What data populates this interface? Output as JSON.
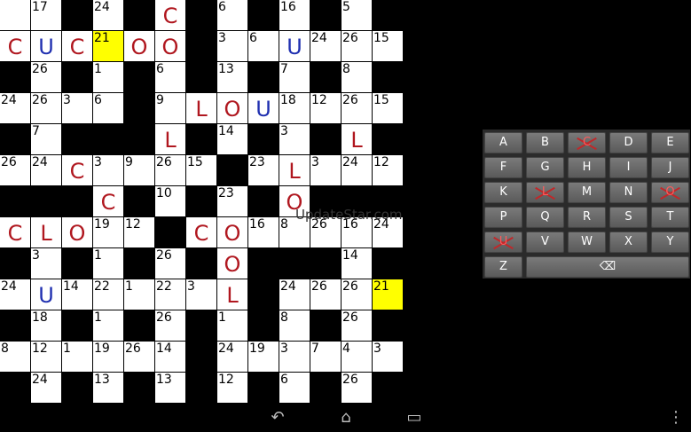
{
  "grid": {
    "rows": [
      [
        {
          "t": "w"
        },
        {
          "t": "w",
          "n": "17"
        },
        {
          "t": "b"
        },
        {
          "t": "w",
          "n": "24"
        },
        {
          "t": "b"
        },
        {
          "t": "w",
          "l": "C",
          "c": "red"
        },
        {
          "t": "b"
        },
        {
          "t": "w",
          "n": "6"
        },
        {
          "t": "b"
        },
        {
          "t": "w",
          "n": "16"
        },
        {
          "t": "b"
        },
        {
          "t": "w",
          "n": "5"
        },
        {
          "t": "b"
        }
      ],
      [
        {
          "t": "w",
          "l": "C",
          "c": "red"
        },
        {
          "t": "w",
          "l": "U",
          "c": "blue"
        },
        {
          "t": "w",
          "l": "C",
          "c": "red"
        },
        {
          "t": "h",
          "n": "21"
        },
        {
          "t": "w",
          "l": "O",
          "c": "red"
        },
        {
          "t": "w",
          "l": "O",
          "c": "red"
        },
        {
          "t": "b"
        },
        {
          "t": "w",
          "n": "3"
        },
        {
          "t": "w",
          "n": "6"
        },
        {
          "t": "w",
          "l": "U",
          "c": "blue"
        },
        {
          "t": "w",
          "n": "24"
        },
        {
          "t": "w",
          "n": "26"
        },
        {
          "t": "w",
          "n": "15"
        }
      ],
      [
        {
          "t": "b"
        },
        {
          "t": "w",
          "n": "26"
        },
        {
          "t": "b"
        },
        {
          "t": "w",
          "n": "1"
        },
        {
          "t": "b"
        },
        {
          "t": "w",
          "n": "6"
        },
        {
          "t": "b"
        },
        {
          "t": "w",
          "n": "13"
        },
        {
          "t": "b"
        },
        {
          "t": "w",
          "n": "7"
        },
        {
          "t": "b"
        },
        {
          "t": "w",
          "n": "8"
        },
        {
          "t": "b"
        }
      ],
      [
        {
          "t": "w",
          "n": "24"
        },
        {
          "t": "w",
          "n": "26"
        },
        {
          "t": "w",
          "n": "3"
        },
        {
          "t": "w",
          "n": "6"
        },
        {
          "t": "b"
        },
        {
          "t": "w",
          "n": "9"
        },
        {
          "t": "w",
          "l": "L",
          "c": "red"
        },
        {
          "t": "w",
          "l": "O",
          "c": "red"
        },
        {
          "t": "w",
          "l": "U",
          "c": "blue"
        },
        {
          "t": "w",
          "n": "18"
        },
        {
          "t": "w",
          "n": "12"
        },
        {
          "t": "w",
          "n": "26"
        },
        {
          "t": "w",
          "n": "15"
        }
      ],
      [
        {
          "t": "b"
        },
        {
          "t": "w",
          "n": "7"
        },
        {
          "t": "b"
        },
        {
          "t": "b"
        },
        {
          "t": "b"
        },
        {
          "t": "w",
          "l": "L",
          "c": "red"
        },
        {
          "t": "b"
        },
        {
          "t": "w",
          "n": "14"
        },
        {
          "t": "b"
        },
        {
          "t": "w",
          "n": "3"
        },
        {
          "t": "b"
        },
        {
          "t": "w",
          "l": "L",
          "c": "red"
        },
        {
          "t": "b"
        }
      ],
      [
        {
          "t": "w",
          "n": "26"
        },
        {
          "t": "w",
          "n": "24"
        },
        {
          "t": "w",
          "l": "C",
          "c": "red"
        },
        {
          "t": "w",
          "n": "3"
        },
        {
          "t": "w",
          "n": "9"
        },
        {
          "t": "w",
          "n": "26"
        },
        {
          "t": "w",
          "n": "15"
        },
        {
          "t": "b"
        },
        {
          "t": "w",
          "n": "23"
        },
        {
          "t": "w",
          "l": "L",
          "c": "red"
        },
        {
          "t": "w",
          "n": "3"
        },
        {
          "t": "w",
          "n": "24"
        },
        {
          "t": "w",
          "n": "12"
        }
      ],
      [
        {
          "t": "b"
        },
        {
          "t": "b"
        },
        {
          "t": "b"
        },
        {
          "t": "w",
          "l": "C",
          "c": "red"
        },
        {
          "t": "b"
        },
        {
          "t": "w",
          "n": "10"
        },
        {
          "t": "b"
        },
        {
          "t": "w",
          "n": "23"
        },
        {
          "t": "b"
        },
        {
          "t": "w",
          "l": "O",
          "c": "red"
        },
        {
          "t": "b"
        },
        {
          "t": "b"
        },
        {
          "t": "b"
        }
      ],
      [
        {
          "t": "w",
          "l": "C",
          "c": "red"
        },
        {
          "t": "w",
          "l": "L",
          "c": "red"
        },
        {
          "t": "w",
          "l": "O",
          "c": "red"
        },
        {
          "t": "w",
          "n": "19"
        },
        {
          "t": "w",
          "n": "12"
        },
        {
          "t": "b"
        },
        {
          "t": "w",
          "l": "C",
          "c": "red"
        },
        {
          "t": "w",
          "l": "O",
          "c": "red"
        },
        {
          "t": "w",
          "n": "16"
        },
        {
          "t": "w",
          "n": "8"
        },
        {
          "t": "w",
          "n": "26"
        },
        {
          "t": "w",
          "n": "16"
        },
        {
          "t": "w",
          "n": "24"
        }
      ],
      [
        {
          "t": "b"
        },
        {
          "t": "w",
          "n": "3"
        },
        {
          "t": "b"
        },
        {
          "t": "w",
          "n": "1"
        },
        {
          "t": "b"
        },
        {
          "t": "w",
          "n": "26"
        },
        {
          "t": "b"
        },
        {
          "t": "w",
          "l": "O",
          "c": "red"
        },
        {
          "t": "b"
        },
        {
          "t": "b"
        },
        {
          "t": "b"
        },
        {
          "t": "w",
          "n": "14"
        },
        {
          "t": "b"
        }
      ],
      [
        {
          "t": "w",
          "n": "24"
        },
        {
          "t": "w",
          "l": "U",
          "c": "blue"
        },
        {
          "t": "w",
          "n": "14"
        },
        {
          "t": "w",
          "n": "22"
        },
        {
          "t": "w",
          "n": "1"
        },
        {
          "t": "w",
          "n": "22"
        },
        {
          "t": "w",
          "n": "3"
        },
        {
          "t": "w",
          "l": "L",
          "c": "red"
        },
        {
          "t": "b"
        },
        {
          "t": "w",
          "n": "24"
        },
        {
          "t": "w",
          "n": "26"
        },
        {
          "t": "w",
          "n": "26"
        },
        {
          "t": "h",
          "n": "21"
        }
      ],
      [
        {
          "t": "b"
        },
        {
          "t": "w",
          "n": "18"
        },
        {
          "t": "b"
        },
        {
          "t": "w",
          "n": "1"
        },
        {
          "t": "b"
        },
        {
          "t": "w",
          "n": "26"
        },
        {
          "t": "b"
        },
        {
          "t": "w",
          "n": "1"
        },
        {
          "t": "b"
        },
        {
          "t": "w",
          "n": "8"
        },
        {
          "t": "b"
        },
        {
          "t": "w",
          "n": "26"
        },
        {
          "t": "b"
        }
      ],
      [
        {
          "t": "w",
          "n": "8"
        },
        {
          "t": "w",
          "n": "12"
        },
        {
          "t": "w",
          "n": "1"
        },
        {
          "t": "w",
          "n": "19"
        },
        {
          "t": "w",
          "n": "26"
        },
        {
          "t": "w",
          "n": "14"
        },
        {
          "t": "b"
        },
        {
          "t": "w",
          "n": "24"
        },
        {
          "t": "w",
          "n": "19"
        },
        {
          "t": "w",
          "n": "3"
        },
        {
          "t": "w",
          "n": "7"
        },
        {
          "t": "w",
          "n": "4"
        },
        {
          "t": "w",
          "n": "3"
        }
      ],
      [
        {
          "t": "b"
        },
        {
          "t": "w",
          "n": "24"
        },
        {
          "t": "b"
        },
        {
          "t": "w",
          "n": "13"
        },
        {
          "t": "b"
        },
        {
          "t": "w",
          "n": "13"
        },
        {
          "t": "b"
        },
        {
          "t": "w",
          "n": "12"
        },
        {
          "t": "b"
        },
        {
          "t": "w",
          "n": "6"
        },
        {
          "t": "b"
        },
        {
          "t": "w",
          "n": "26"
        },
        {
          "t": "b"
        }
      ]
    ]
  },
  "watermark": "UpdateStar.com",
  "keyboard": {
    "rows": [
      [
        {
          "k": "A"
        },
        {
          "k": "B"
        },
        {
          "k": "C",
          "used": true
        },
        {
          "k": "D"
        },
        {
          "k": "E"
        }
      ],
      [
        {
          "k": "F"
        },
        {
          "k": "G"
        },
        {
          "k": "H"
        },
        {
          "k": "I"
        },
        {
          "k": "J"
        }
      ],
      [
        {
          "k": "K"
        },
        {
          "k": "L",
          "used": true
        },
        {
          "k": "M"
        },
        {
          "k": "N"
        },
        {
          "k": "O",
          "used": true
        }
      ],
      [
        {
          "k": "P"
        },
        {
          "k": "Q"
        },
        {
          "k": "R"
        },
        {
          "k": "S"
        },
        {
          "k": "T"
        }
      ],
      [
        {
          "k": "U",
          "used": true
        },
        {
          "k": "V"
        },
        {
          "k": "W"
        },
        {
          "k": "X"
        },
        {
          "k": "Y"
        }
      ]
    ],
    "last_key": "Z",
    "backspace_icon": "backspace-icon"
  },
  "navbar": {
    "back": "back-icon",
    "home": "home-icon",
    "recents": "recents-icon",
    "menu": "menu-icon"
  },
  "colors": {
    "highlight": "#ffff00",
    "solved_red": "#b0171f",
    "solved_blue": "#1f2fb0"
  }
}
